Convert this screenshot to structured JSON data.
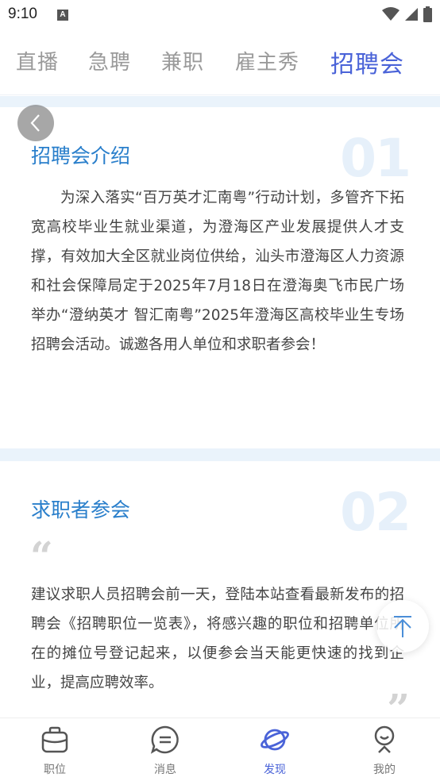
{
  "status_bar": {
    "time": "9:10",
    "notification_badge": "A",
    "icons": [
      "wifi-icon",
      "signal-icon",
      "battery-icon"
    ]
  },
  "tabs": [
    {
      "label": "直播",
      "active": false
    },
    {
      "label": "急聘",
      "active": false
    },
    {
      "label": "兼职",
      "active": false
    },
    {
      "label": "雇主秀",
      "active": false
    },
    {
      "label": "招聘会",
      "active": true
    }
  ],
  "sections": [
    {
      "number": "01",
      "title": "招聘会介绍",
      "text": "为深入落实“百万英才汇南粤”行动计划，多管齐下拓宽高校毕业生就业渠道，为澄海区产业发展提供人才支撑，有效加大全区就业岗位供给，汕头市澄海区人力资源和社会保障局定于2025年7月18日在澄海奥飞市民广场举办“澄纳英才 智汇南粤”2025年澄海区高校毕业生专场招聘会活动。诚邀各用人单位和求职者参会！"
    },
    {
      "number": "02",
      "title": "求职者参会",
      "quote_open": "“",
      "quote_close": "”",
      "text": "建议求职人员招聘会前一天，登陆本站查看最新发布的招聘会《招聘职位一览表》，将感兴趣的职位和招聘单位所在的摊位号登记起来，以便参会当天能更快速的找到企业，提高应聘效率。"
    }
  ],
  "bottom_nav": [
    {
      "label": "职位",
      "icon": "briefcase-icon",
      "active": false
    },
    {
      "label": "消息",
      "icon": "message-icon",
      "active": false
    },
    {
      "label": "发现",
      "icon": "planet-icon",
      "active": true
    },
    {
      "label": "我的",
      "icon": "profile-icon",
      "active": false
    }
  ],
  "colors": {
    "accent": "#4a63d8",
    "title_blue": "#2a7fcb",
    "inactive_tab": "#9a9a9a",
    "section_bg": "#eaf3fb"
  }
}
